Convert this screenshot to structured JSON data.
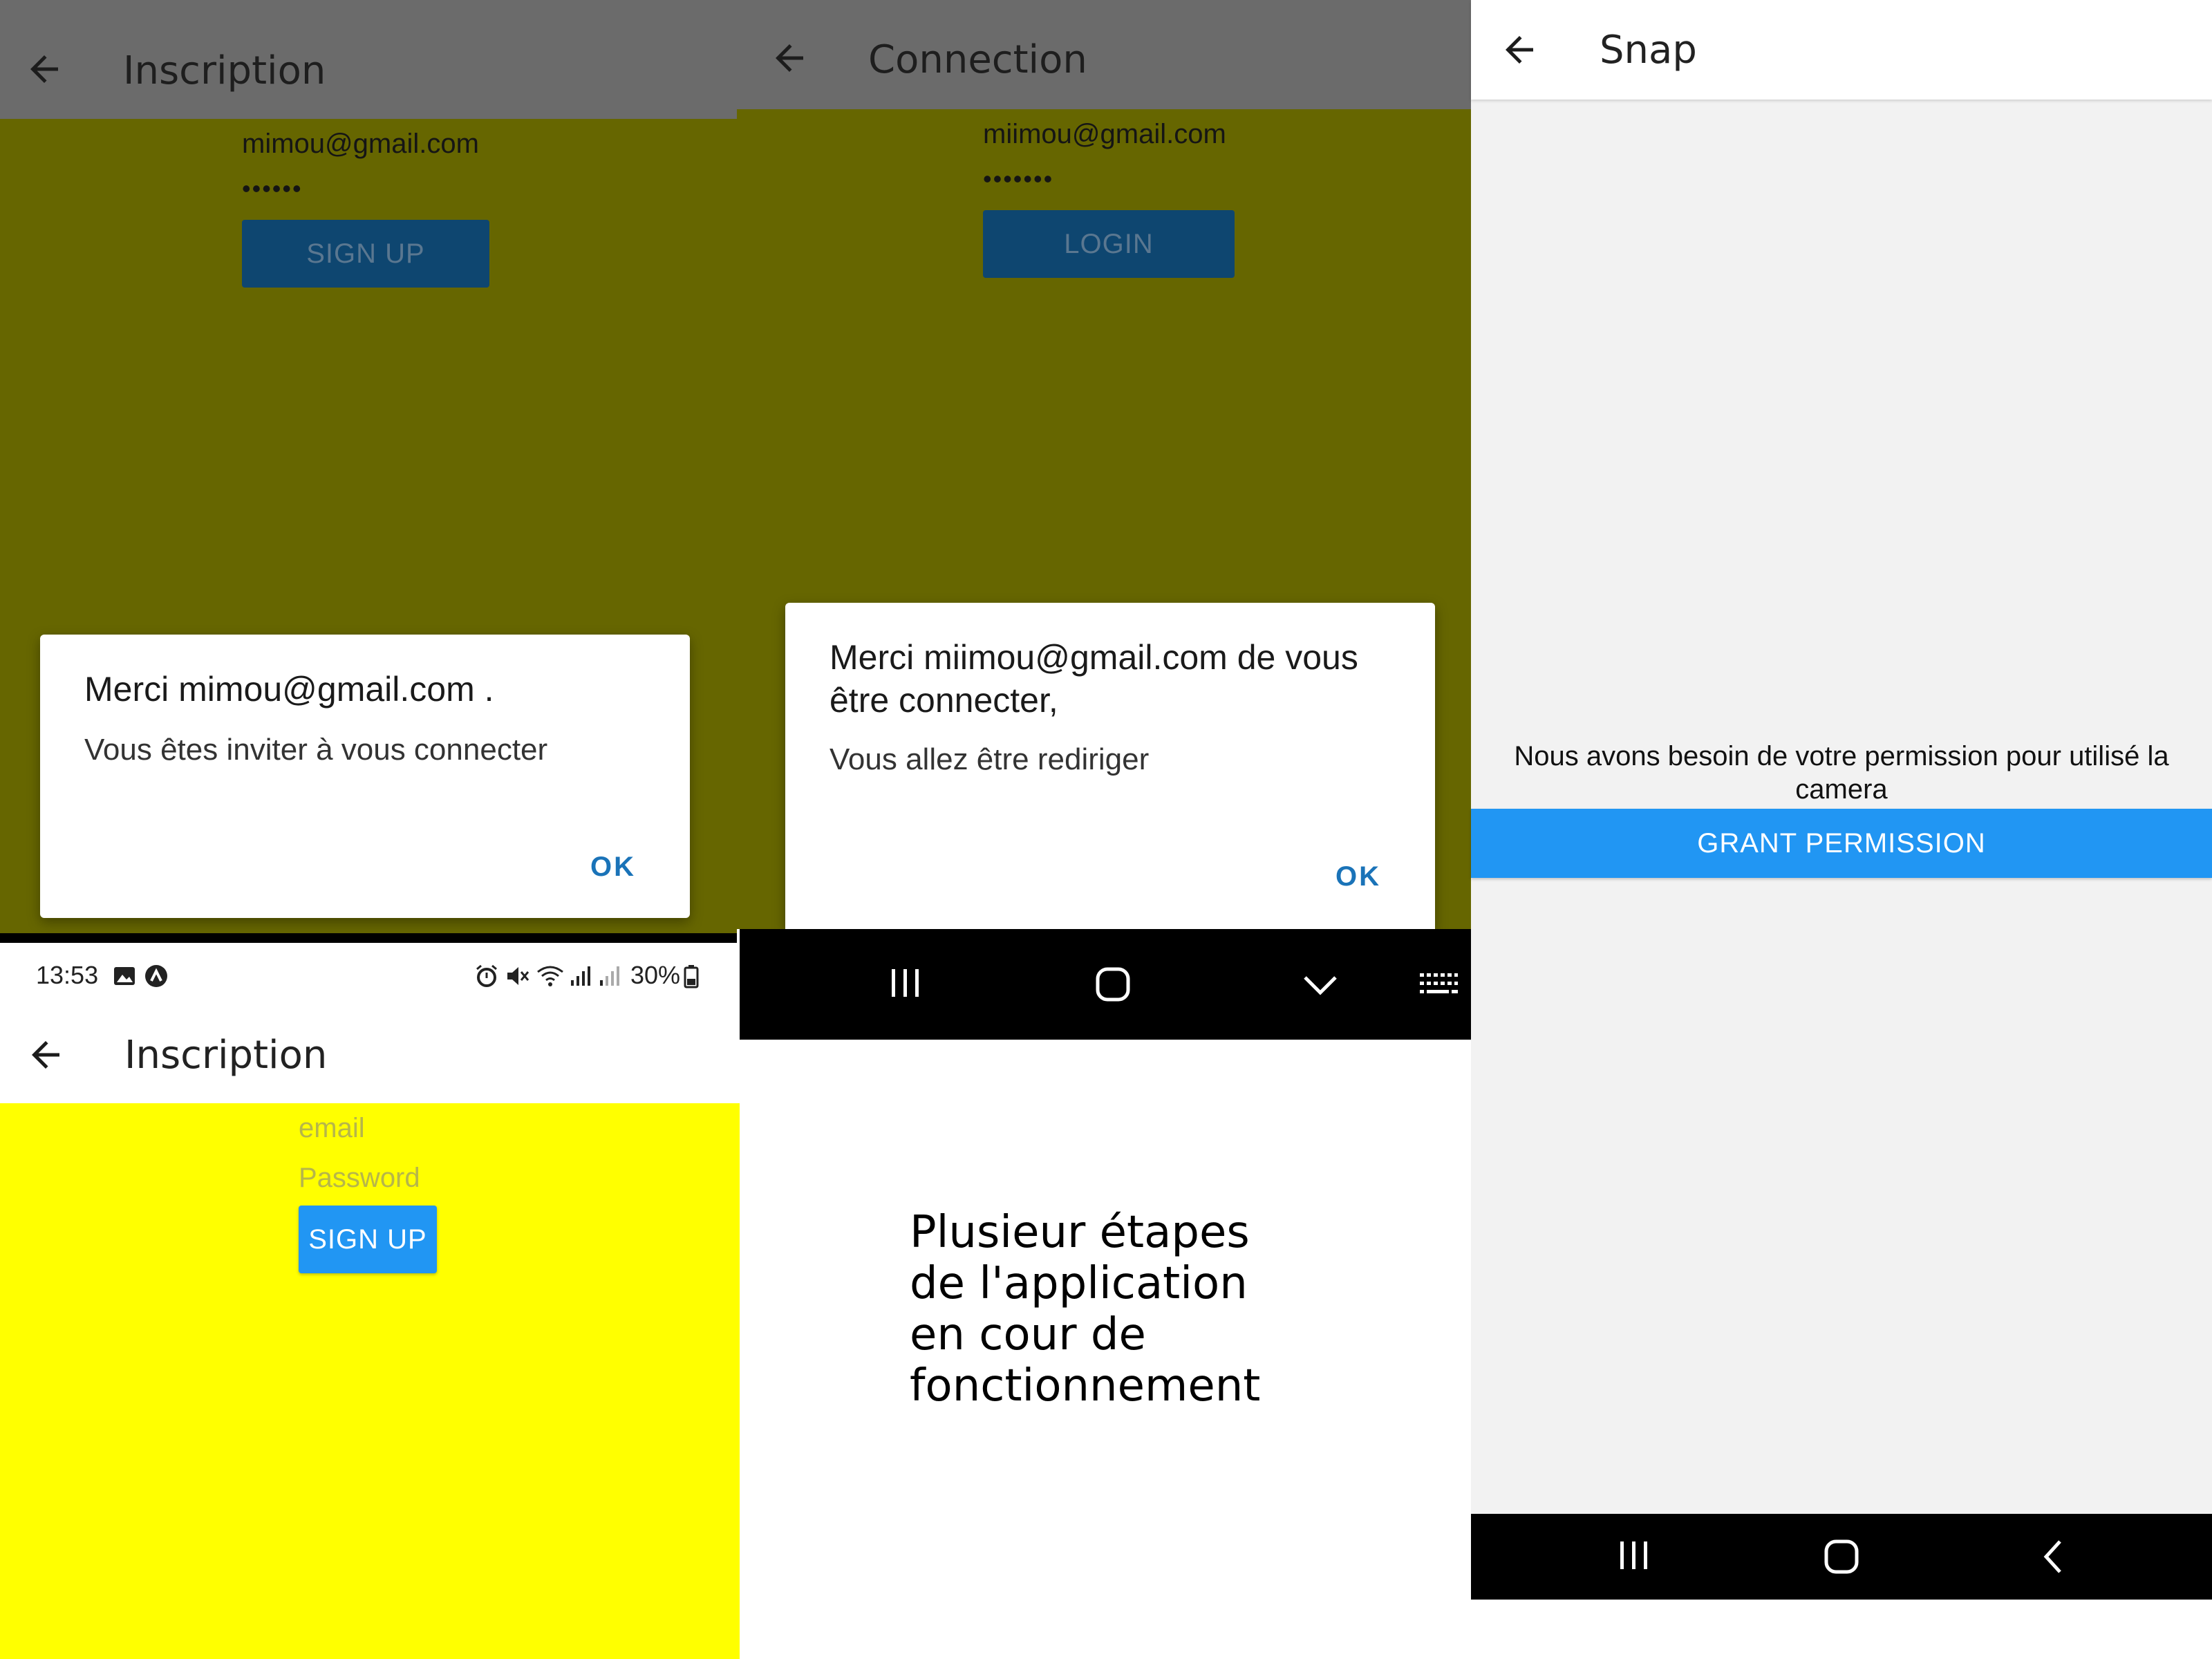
{
  "panel1": {
    "title": "Inscription",
    "email_value": "mimou@gmail.com",
    "password_value": "••••••",
    "button_label": "SIGN UP",
    "dialog": {
      "title": "Merci mimou@gmail.com .",
      "message": "Vous êtes inviter à vous connecter",
      "ok_label": "OK"
    }
  },
  "panel2": {
    "title": "Connection",
    "email_value": "miimou@gmail.com",
    "password_value": "•••••••",
    "button_label": "LOGIN",
    "dialog": {
      "title": "Merci miimou@gmail.com de vous être connecter,",
      "message": "Vous allez être rediriger",
      "ok_label": "OK"
    },
    "navbar": {
      "recents_icon": "recents-icon",
      "home_icon": "home-icon",
      "hide_keyboard_icon": "chevron-down-icon",
      "keyboard_icon": "keyboard-icon"
    }
  },
  "panel3": {
    "title": "Snap",
    "permission_message": "Nous avons besoin de votre permission pour utilisé la camera",
    "grant_button_label": "GRANT PERMISSION",
    "navbar": {
      "recents_icon": "recents-icon",
      "home_icon": "home-icon",
      "back_icon": "back-chevron-icon"
    }
  },
  "panel4": {
    "status_bar": {
      "time": "13:53",
      "battery": "30%",
      "icons": [
        "image-icon",
        "app-icon",
        "alarm-icon",
        "mute-icon",
        "wifi-icon",
        "signal-icon",
        "signal-icon",
        "battery-icon"
      ]
    },
    "title": "Inscription",
    "email_placeholder": "email",
    "password_placeholder": "Password",
    "button_label": "SIGN UP"
  },
  "caption": {
    "lines": [
      "Plusieur étapes",
      "de l'application",
      "en cour de",
      "fonctionnement"
    ]
  },
  "colors": {
    "dim_olive": "#666600",
    "dim_appbar": "#6b6b6b",
    "dim_button": "#0e4670",
    "dim_button_text": "#5a7790",
    "yellow": "#ffff00",
    "blue": "#2196f3",
    "snap_bg": "#f2f2f2",
    "ok_blue": "#1a73b8"
  }
}
